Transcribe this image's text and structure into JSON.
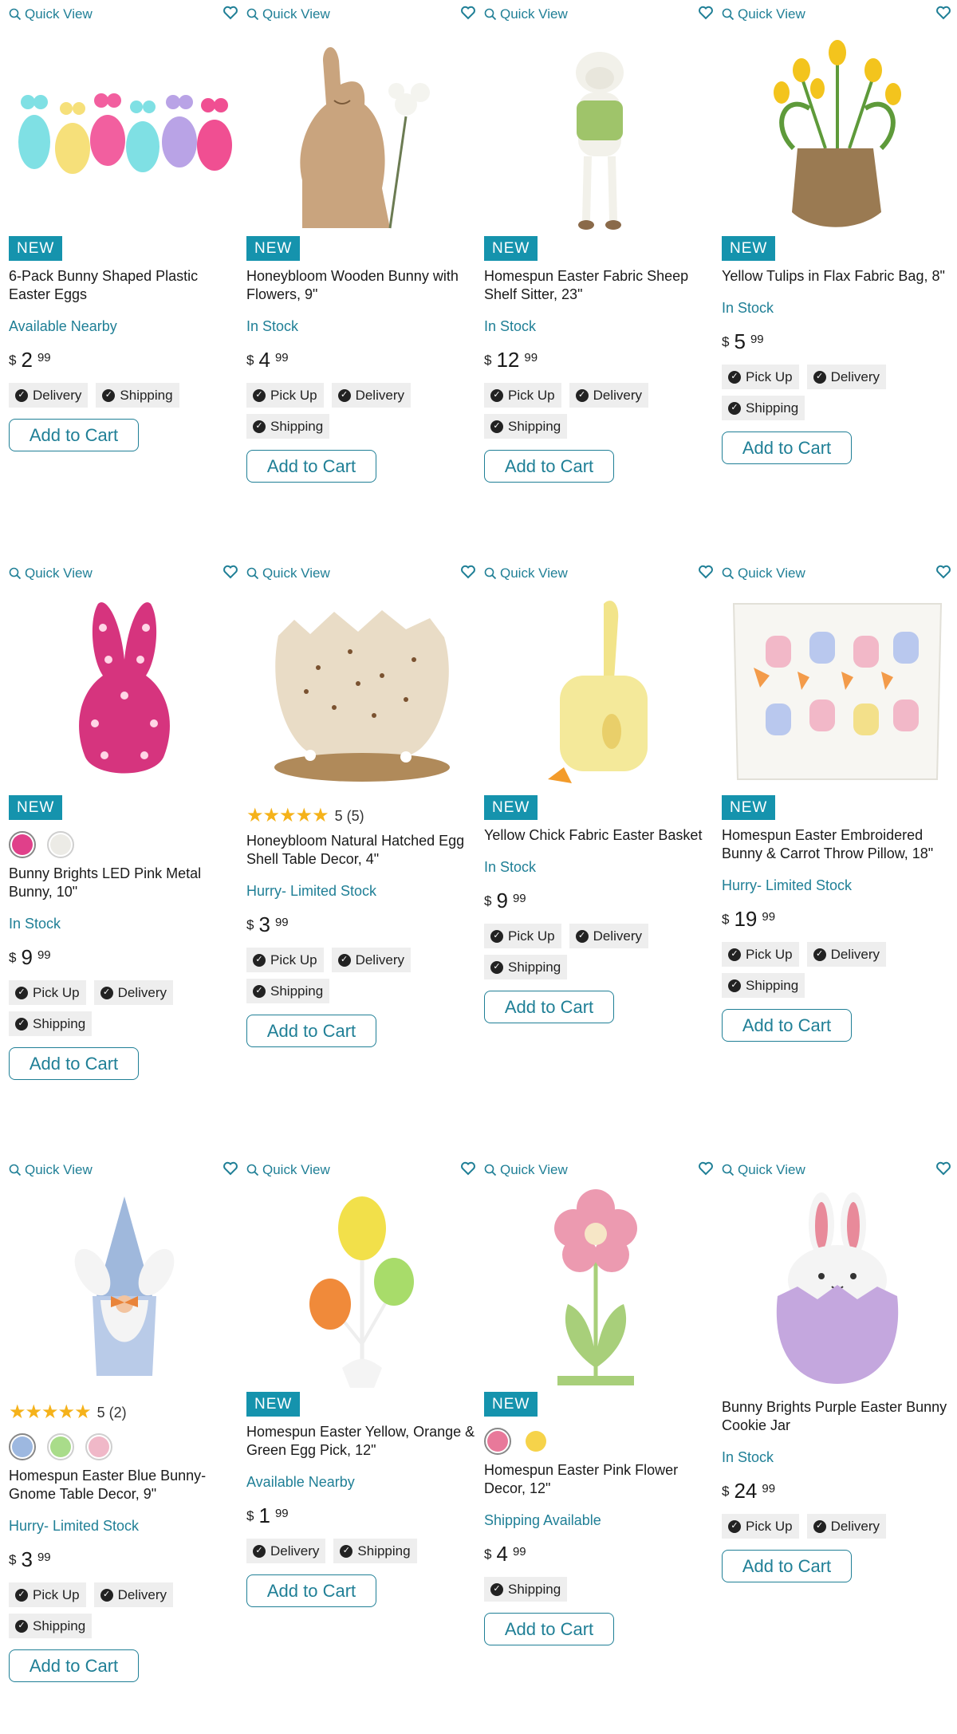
{
  "quick_view_label": "Quick View",
  "add_to_cart_label": "Add to Cart",
  "new_badge_label": "NEW",
  "colors": {
    "accent": "#1f7f96",
    "badge": "#1593ad",
    "chip_bg": "#eeeeee",
    "star": "#f5b21a"
  },
  "products": [
    {
      "title": "6-Pack Bunny Shaped Plastic Easter Eggs",
      "stock": "Available Nearby",
      "price": {
        "currency": "$",
        "dollars": "2",
        "cents": "99"
      },
      "badge": true,
      "chips": [
        "Delivery",
        "Shipping"
      ]
    },
    {
      "title": "Honeybloom Wooden Bunny with Flowers, 9\"",
      "stock": "In Stock",
      "price": {
        "currency": "$",
        "dollars": "4",
        "cents": "99"
      },
      "badge": true,
      "chips": [
        "Pick Up",
        "Delivery",
        "Shipping"
      ]
    },
    {
      "title": "Homespun Easter Fabric Sheep Shelf Sitter, 23\"",
      "stock": "In Stock",
      "price": {
        "currency": "$",
        "dollars": "12",
        "cents": "99"
      },
      "badge": true,
      "chips": [
        "Pick Up",
        "Delivery",
        "Shipping"
      ]
    },
    {
      "title": "Yellow Tulips in Flax Fabric Bag, 8\"",
      "stock": "In Stock",
      "price": {
        "currency": "$",
        "dollars": "5",
        "cents": "99"
      },
      "badge": true,
      "chips": [
        "Pick Up",
        "Delivery",
        "Shipping"
      ]
    },
    {
      "title": "Bunny Brights LED Pink Metal Bunny, 10\"",
      "stock": "In Stock",
      "price": {
        "currency": "$",
        "dollars": "9",
        "cents": "99"
      },
      "badge": true,
      "swatches": [
        "#e0408a",
        "#ecebe6"
      ],
      "chips": [
        "Pick Up",
        "Delivery",
        "Shipping"
      ]
    },
    {
      "title": "Honeybloom Natural Hatched Egg Shell Table Decor, 4\"",
      "stock": "Hurry- Limited Stock",
      "price": {
        "currency": "$",
        "dollars": "3",
        "cents": "99"
      },
      "badge": false,
      "rating": {
        "stars": 5,
        "text": "5 (5)"
      },
      "chips": [
        "Pick Up",
        "Delivery",
        "Shipping"
      ]
    },
    {
      "title": "Yellow Chick Fabric Easter Basket",
      "stock": "In Stock",
      "price": {
        "currency": "$",
        "dollars": "9",
        "cents": "99"
      },
      "badge": true,
      "chips": [
        "Pick Up",
        "Delivery",
        "Shipping"
      ]
    },
    {
      "title": "Homespun Easter Embroidered Bunny & Carrot Throw Pillow, 18\"",
      "stock": "Hurry- Limited Stock",
      "price": {
        "currency": "$",
        "dollars": "19",
        "cents": "99"
      },
      "badge": true,
      "chips": [
        "Pick Up",
        "Delivery",
        "Shipping"
      ]
    },
    {
      "title": "Homespun Easter Blue Bunny-Gnome Table Decor, 9\"",
      "stock": "Hurry- Limited Stock",
      "price": {
        "currency": "$",
        "dollars": "3",
        "cents": "99"
      },
      "badge": false,
      "rating": {
        "stars": 5,
        "text": "5 (2)"
      },
      "swatches": [
        "#9db8e0",
        "#a9dc8a",
        "#f0b8c8"
      ],
      "chips": [
        "Pick Up",
        "Delivery",
        "Shipping"
      ]
    },
    {
      "title": "Homespun Easter Yellow, Orange & Green Egg Pick, 12\"",
      "stock": "Available Nearby",
      "price": {
        "currency": "$",
        "dollars": "1",
        "cents": "99"
      },
      "badge": true,
      "chips": [
        "Delivery",
        "Shipping"
      ]
    },
    {
      "title": "Homespun Easter Pink Flower Decor, 12\"",
      "stock": "Shipping Available",
      "price": {
        "currency": "$",
        "dollars": "4",
        "cents": "99"
      },
      "badge": true,
      "swatches": [
        "#e8799a",
        "#f6d34a"
      ],
      "chips": [
        "Shipping"
      ]
    },
    {
      "title": "Bunny Brights Purple Easter Bunny Cookie Jar",
      "stock": "In Stock",
      "price": {
        "currency": "$",
        "dollars": "24",
        "cents": "99"
      },
      "badge": false,
      "chips": [
        "Pick Up",
        "Delivery"
      ]
    }
  ]
}
